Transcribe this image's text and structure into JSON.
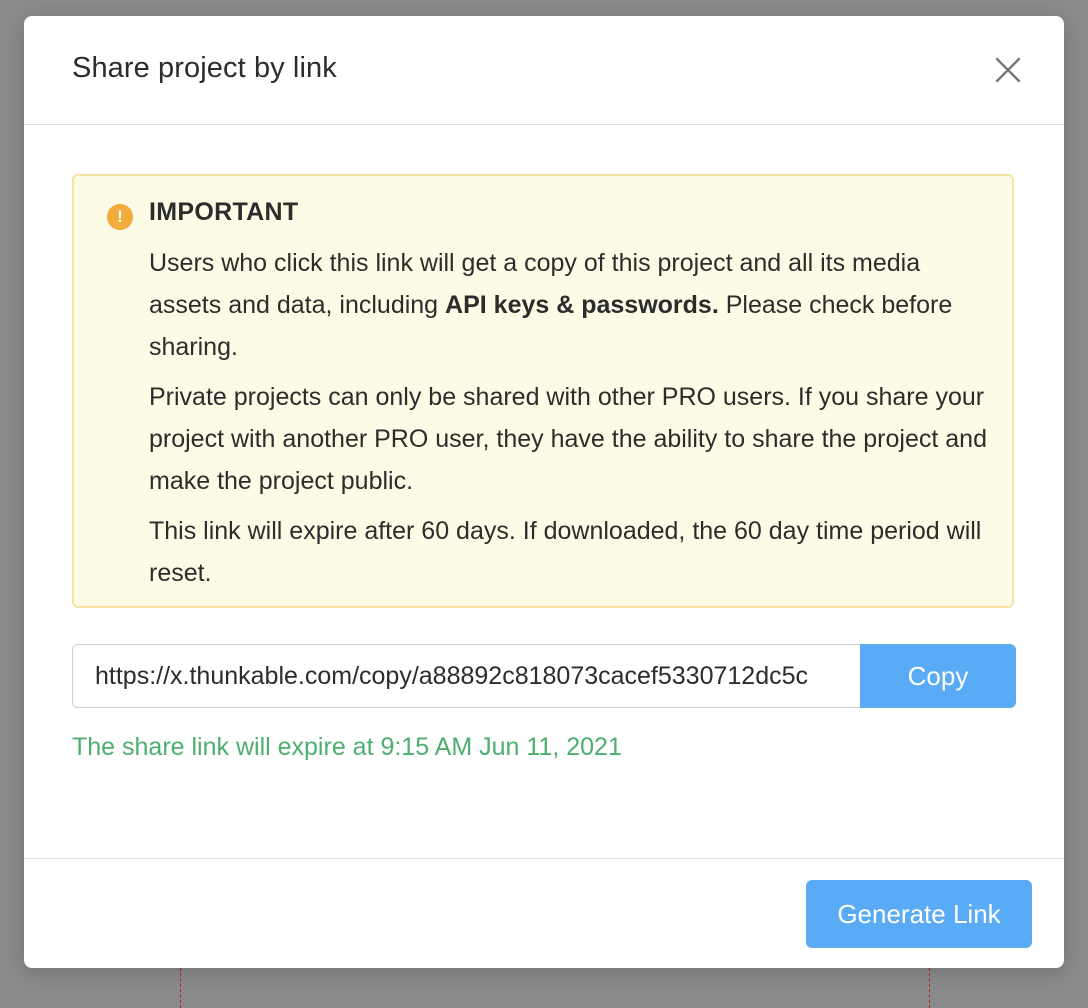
{
  "dialog": {
    "title": "Share project by link",
    "close_icon": "close-icon"
  },
  "alert": {
    "icon": "warning-icon",
    "icon_glyph": "!",
    "icon_color": "#f3ab3b",
    "background": "#fdfbe6",
    "title": "IMPORTANT",
    "p1_before": "Users who click this link will get a copy of this project and all its media assets and data, including ",
    "p1_bold": "API keys & passwords.",
    "p1_after": " Please check before sharing.",
    "p2": "Private projects can only be shared with other PRO users. If you share your project with another PRO user, they have the ability to share the project and make the project public.",
    "p3": "This link will expire after 60 days. If downloaded, the 60 day time period will reset."
  },
  "share_link": {
    "value": "https://x.thunkable.com/copy/a88892c818073cacef5330712dc5c",
    "copy_label": "Copy",
    "expire_text": "The share link will expire at 9:15 AM Jun 11, 2021"
  },
  "footer": {
    "generate_label": "Generate Link"
  },
  "colors": {
    "accent": "#5aabf6",
    "success_text": "#4caf6e"
  }
}
